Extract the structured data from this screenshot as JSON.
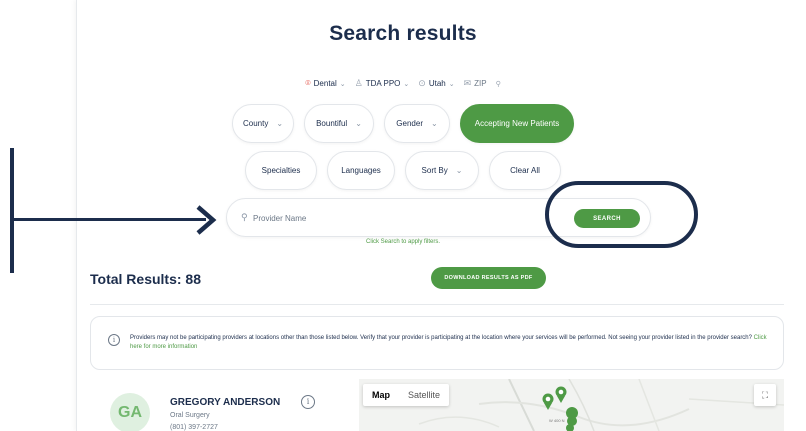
{
  "page": {
    "title": "Search results"
  },
  "filter_summary": [
    {
      "label": "Dental",
      "icon": "tooth-icon",
      "chevron": "⌄"
    },
    {
      "label": "TDA PPO",
      "icon": "person-icon",
      "chevron": "⌄"
    },
    {
      "label": "Utah",
      "icon": "location-pin-icon",
      "chevron": "⌄"
    },
    {
      "label": "ZIP",
      "icon": "mail-icon"
    }
  ],
  "filters_row1": [
    {
      "label": "County",
      "chevron": "⌄"
    },
    {
      "label": "Bountiful",
      "chevron": "⌄"
    },
    {
      "label": "Gender",
      "chevron": "⌄"
    },
    {
      "label": "Accepting New Patients"
    }
  ],
  "filters_row2": [
    {
      "label": "Specialties"
    },
    {
      "label": "Languages"
    },
    {
      "label": "Sort By",
      "chevron": "⌄"
    },
    {
      "label": "Clear All"
    }
  ],
  "search": {
    "placeholder": "Provider Name",
    "button_label": "SEARCH",
    "hint": "Click Search to apply filters."
  },
  "results": {
    "total_label": "Total Results: 88",
    "pdf_button": "DOWNLOAD RESULTS AS PDF"
  },
  "notice": {
    "text": "Providers may not be participating providers at locations other than those listed below. Verify that your provider is participating at the location where your services will be performed. Not seeing your provider listed in the provider search?",
    "link": "Click here for more information"
  },
  "provider": {
    "initials": "GA",
    "name": "GREGORY ANDERSON",
    "specialty": "Oral Surgery",
    "phone": "(801) 397-2727"
  },
  "map": {
    "tab_map": "Map",
    "tab_satellite": "Satellite",
    "street_label": "W 400 N"
  },
  "colors": {
    "brand_green": "#4e9a45",
    "navy": "#1c2d4c",
    "pin_red": "#e0453a"
  }
}
